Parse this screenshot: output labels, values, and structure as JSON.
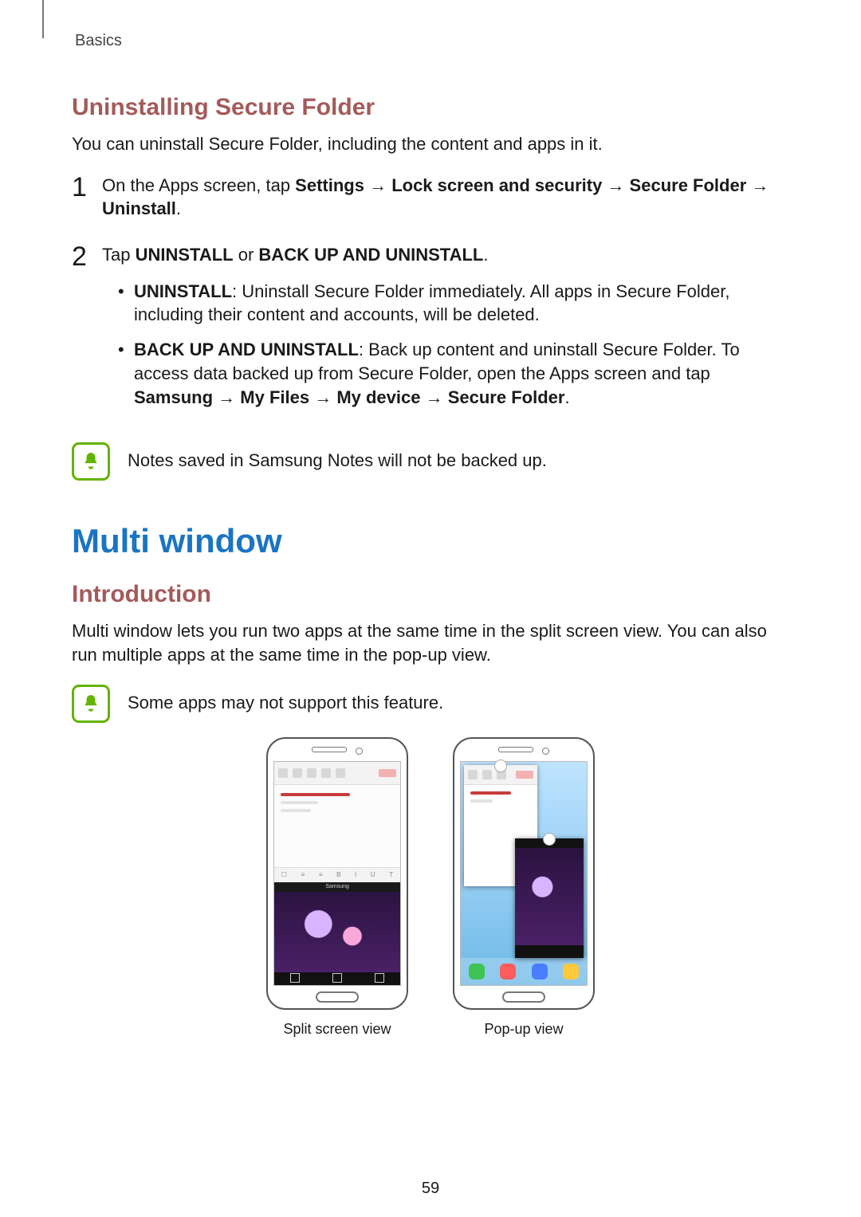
{
  "header": {
    "section": "Basics"
  },
  "uninstall": {
    "heading": "Uninstalling Secure Folder",
    "intro": "You can uninstall Secure Folder, including the content and apps in it.",
    "step1": {
      "num": "1",
      "pre": "On the Apps screen, tap ",
      "b1": "Settings",
      "arr1": " → ",
      "b2": "Lock screen and security",
      "arr2": " → ",
      "b3": "Secure Folder",
      "arr3": " → ",
      "b4": "Uninstall",
      "post": "."
    },
    "step2": {
      "num": "2",
      "pre": "Tap ",
      "b1": "UNINSTALL",
      "mid": " or ",
      "b2": "BACK UP AND UNINSTALL",
      "post": ".",
      "opt1": {
        "label": "UNINSTALL",
        "text": ": Uninstall Secure Folder immediately. All apps in Secure Folder, including their content and accounts, will be deleted."
      },
      "opt2": {
        "label": "BACK UP AND UNINSTALL",
        "t1": ": Back up content and uninstall Secure Folder. To access data backed up from Secure Folder, open the Apps screen and tap ",
        "p1": "Samsung",
        "a1": " → ",
        "p2": "My Files",
        "a2": " → ",
        "p3": "My device",
        "a3": " → ",
        "p4": "Secure Folder",
        "t2": "."
      }
    },
    "note": {
      "pre": "Notes saved in ",
      "bold": "Samsung Notes",
      "post": " will not be backed up."
    }
  },
  "multiwindow": {
    "heading": "Multi window",
    "sub": "Introduction",
    "body": "Multi window lets you run two apps at the same time in the split screen view. You can also run multiple apps at the same time in the pop-up view.",
    "note": "Some apps may not support this feature.",
    "cap1": "Split screen view",
    "cap2": "Pop-up view"
  },
  "pageNumber": "59"
}
